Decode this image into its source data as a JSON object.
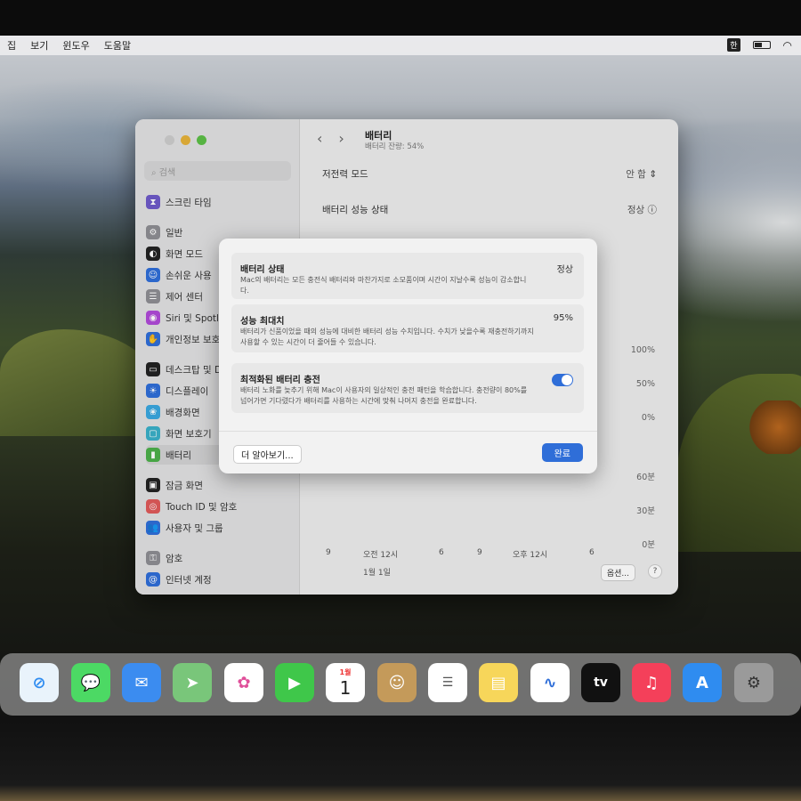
{
  "menubar": {
    "items": [
      "집",
      "보기",
      "윈도우",
      "도움말"
    ],
    "input_indicator": "한"
  },
  "sidebar": {
    "search_placeholder": "검색",
    "items": [
      {
        "label": "스크린 타임",
        "icon": "hourglass-icon",
        "color": "#6e5ac8"
      },
      {
        "label": "일반",
        "icon": "gear-icon",
        "color": "#8e8e93"
      },
      {
        "label": "화면 모드",
        "icon": "appearance-icon",
        "color": "#222222"
      },
      {
        "label": "손쉬운 사용",
        "icon": "accessibility-icon",
        "color": "#2f6ed8"
      },
      {
        "label": "제어 센터",
        "icon": "control-center-icon",
        "color": "#8e8e93"
      },
      {
        "label": "Siri 및 Spotlight",
        "icon": "siri-icon",
        "color": "#b04ad8"
      },
      {
        "label": "개인정보 보호 및 보안",
        "icon": "hand-icon",
        "color": "#2f6ed8"
      },
      {
        "label": "데스크탑 및 Dock",
        "icon": "dock-icon",
        "color": "#222222"
      },
      {
        "label": "디스플레이",
        "icon": "display-icon",
        "color": "#2f6ed8"
      },
      {
        "label": "배경화면",
        "icon": "wallpaper-icon",
        "color": "#3aa7e0"
      },
      {
        "label": "화면 보호기",
        "icon": "screensaver-icon",
        "color": "#3ab0c8"
      },
      {
        "label": "배터리",
        "icon": "battery-icon",
        "color": "#4cb04a"
      },
      {
        "label": "잠금 화면",
        "icon": "lock-icon",
        "color": "#222222"
      },
      {
        "label": "Touch ID 및 암호",
        "icon": "fingerprint-icon",
        "color": "#e05a5a"
      },
      {
        "label": "사용자 및 그룹",
        "icon": "users-icon",
        "color": "#2f6ed8"
      },
      {
        "label": "암호",
        "icon": "key-icon",
        "color": "#8e8e93"
      },
      {
        "label": "인터넷 계정",
        "icon": "at-icon",
        "color": "#2f6ed8"
      }
    ]
  },
  "main": {
    "title": "배터리",
    "subtitle": "배터리 잔량: 54%",
    "low_power_label": "저전력 모드",
    "low_power_value": "안 함",
    "health_label": "배터리 성능 상태",
    "health_value": "정상",
    "chart_percent_ticks": [
      "100%",
      "50%",
      "0%"
    ],
    "chart_time_ticks": [
      "60분",
      "30분",
      "0분"
    ],
    "x_labels": [
      "9",
      "오전 12시",
      "6",
      "9",
      "오후 12시",
      "6"
    ],
    "date_label": "1월 1일",
    "options_label": "옵션...",
    "help_label": "?"
  },
  "sheet": {
    "status_title": "배터리 상태",
    "status_value": "정상",
    "status_desc": "Mac의 배터리는 모든 충전식 배터리와 마찬가지로 소모품이며 시간이 지날수록 성능이 감소합니다.",
    "capacity_title": "성능 최대치",
    "capacity_value": "95%",
    "capacity_desc": "배터리가 신품이었을 때의 성능에 대비한 배터리 성능 수치입니다. 수치가 낮을수록 재충전하기까지 사용할 수 있는 시간이 더 줄어들 수 있습니다.",
    "optimized_title": "최적화된 배터리 충전",
    "optimized_enabled": true,
    "optimized_desc": "배터리 노화를 늦추기 위해 Mac이 사용자의 일상적인 충전 패턴을 학습합니다. 충전량이 80%를 넘어가면 기다렸다가 배터리를 사용하는 시간에 맞춰 나머지 충전을 완료합니다.",
    "learn_more": "더 알아보기...",
    "done": "완료"
  },
  "dock": {
    "calendar_month": "1월",
    "calendar_day": "1",
    "tv_label": "tv",
    "apps": [
      {
        "name": "safari-icon",
        "color": "#e9f3fb"
      },
      {
        "name": "messages-icon",
        "color": "#4cd964"
      },
      {
        "name": "mail-icon",
        "color": "#3b8cf0"
      },
      {
        "name": "maps-icon",
        "color": "#79c67a"
      },
      {
        "name": "photos-icon",
        "color": "#ffffff"
      },
      {
        "name": "facetime-icon",
        "color": "#3fc74a"
      },
      {
        "name": "calendar-icon",
        "color": "#ffffff"
      },
      {
        "name": "contacts-icon",
        "color": "#c49a5a"
      },
      {
        "name": "reminders-icon",
        "color": "#ffffff"
      },
      {
        "name": "notes-icon",
        "color": "#f7d65a"
      },
      {
        "name": "freeform-icon",
        "color": "#ffffff"
      },
      {
        "name": "appletv-icon",
        "color": "#111111"
      },
      {
        "name": "music-icon",
        "color": "#f4405a"
      },
      {
        "name": "appstore-icon",
        "color": "#2f8cf0"
      },
      {
        "name": "system-settings-icon",
        "color": "#9a9a9a"
      }
    ]
  }
}
